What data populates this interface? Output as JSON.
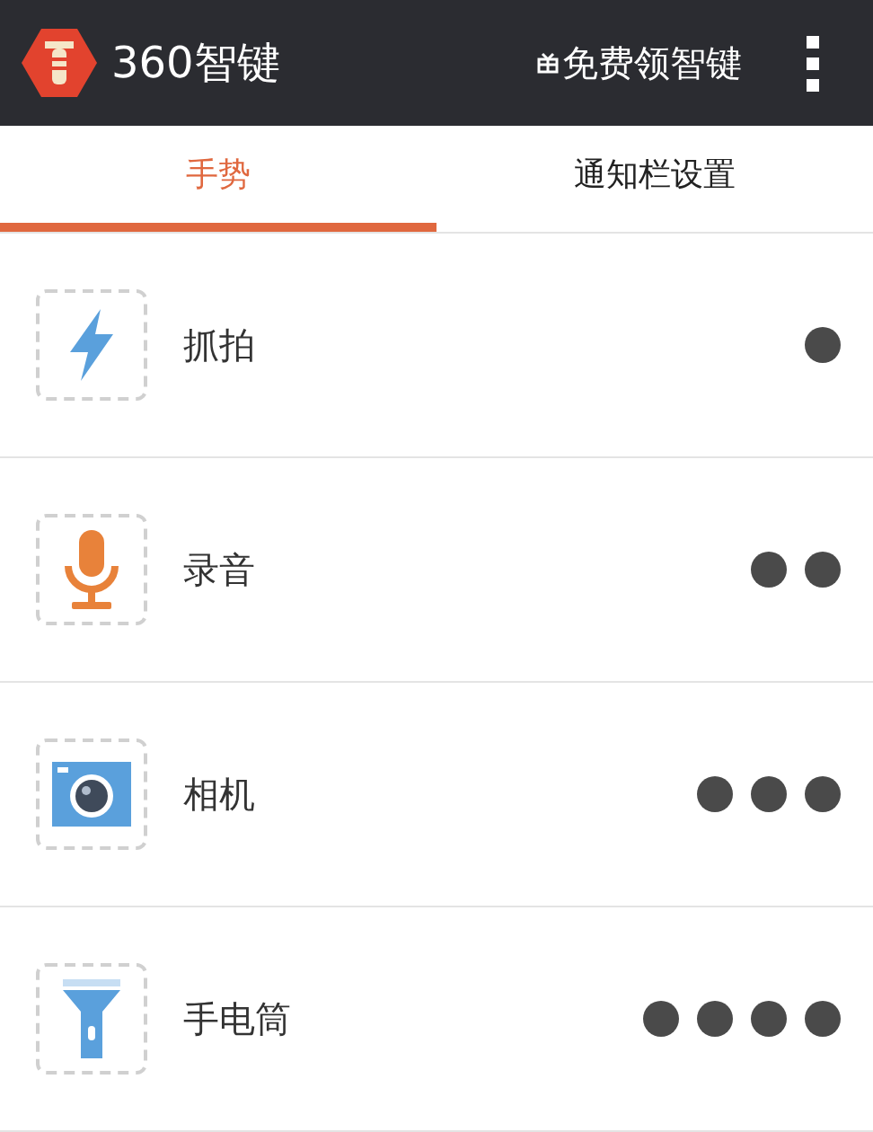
{
  "header": {
    "brand": "360智键",
    "promo": "免费领智键"
  },
  "tabs": [
    {
      "label": "手势",
      "selected": true
    },
    {
      "label": "通知栏设置",
      "selected": false
    }
  ],
  "gestures": [
    {
      "kind": "snap",
      "label": "抓拍"
    },
    {
      "kind": "record",
      "label": "录音"
    },
    {
      "kind": "camera",
      "label": "相机"
    },
    {
      "kind": "flashlight",
      "label": "手电筒"
    }
  ]
}
